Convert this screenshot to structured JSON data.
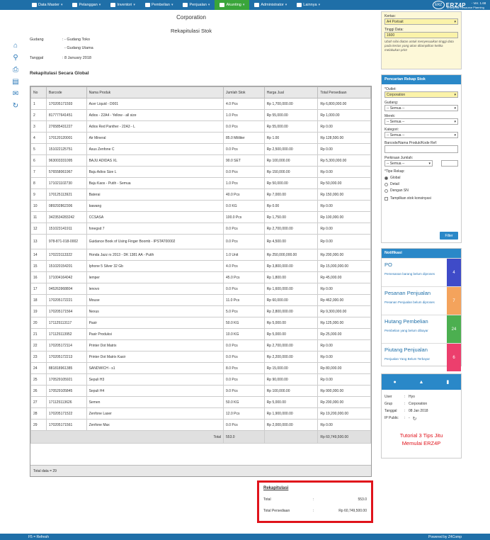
{
  "nav": {
    "items": [
      {
        "label": "Data Master",
        "icon": "list-icon"
      },
      {
        "label": "Pelanggan",
        "icon": "users-icon"
      },
      {
        "label": "Inventori",
        "icon": "box-icon"
      },
      {
        "label": "Pembelian",
        "icon": "cart-icon"
      },
      {
        "label": "Penjualan",
        "icon": "sales-icon"
      },
      {
        "label": "Akunting",
        "icon": "money-icon"
      },
      {
        "label": "Administrator",
        "icon": "gear-icon"
      },
      {
        "label": "Lainnya",
        "icon": "more-icon"
      }
    ],
    "active": "Akunting"
  },
  "brand": {
    "logo": "ERZ",
    "name": "ERZ4P",
    "version": "- Ver. 1.68",
    "tagline": "Enterprise Resource Planning"
  },
  "doc": {
    "company": "Corporation",
    "title": "Rekapitulasi Stok",
    "gudang_label": "Gudang",
    "gudang_1": ": - Gudang Toko",
    "gudang_2": "- Gudang Utama",
    "tanggal_label": "Tanggal",
    "tanggal_value": ": 8 January 2018",
    "section_title": "Rekapitulasi Secara Global"
  },
  "table": {
    "headers": [
      "No",
      "Barcode",
      "Nama Produk",
      "Jumlah Stok",
      "Harga Jual",
      "Total Persediaan"
    ],
    "rows": [
      [
        "1",
        "170205171593",
        "Acer Liquid - D001",
        "4.0 Pcs",
        "Rp 1,700,000.00",
        "Rp 6,800,000.00"
      ],
      [
        "2",
        "817777641451",
        "Adios - 22A4 - Yellow - all size",
        "1.0 Pcs",
        "Rp 55,000.00",
        "Rp 1,000.00"
      ],
      [
        "3",
        "276585431227",
        "Adios Red Panther - 22A3 - L",
        "0.0 Pcs",
        "Rp 55,000.00",
        "Rp 0.00"
      ],
      [
        "4",
        "170120120001",
        "Air Mineral",
        "85.0 Mililiter",
        "Rp 1.00",
        "Rp 128,500.00"
      ],
      [
        "5",
        "151022125751",
        "Asus Zenfone C",
        "0.0 Pcs",
        "Rp 2,500,000.00",
        "Rp 0.00"
      ],
      [
        "6",
        "963003331095",
        "BAJU ADIDAS XL",
        "90.0 SET",
        "Rp 100,000.00",
        "Rp 5,300,000.00"
      ],
      [
        "7",
        "576558061967",
        "Baju Adios Size L",
        "0.0 Pcs",
        "Rp 150,000.00",
        "Rp 0.00"
      ],
      [
        "8",
        "171021102730",
        "Baju Kaos - Putih - Semua",
        "1.0 Pcs",
        "Rp 50,000.00",
        "Rp 50,000.00"
      ],
      [
        "9",
        "170125113921",
        "Baterai",
        "40.0 Pcs",
        "Rp 7,000.00",
        "Rp 150,000.00"
      ],
      [
        "10",
        "089292862306",
        "bawang",
        "0.0 KG",
        "Rp 0.00",
        "Rp 0.00"
      ],
      [
        "11",
        "3423534283242",
        "CCSASA",
        "100.0 Pcs",
        "Rp 1,750.00",
        "Rp 100,000.00"
      ],
      [
        "12",
        "151023141911",
        "fonegsd 7",
        "0.0 Pcs",
        "Rp 2,700,000.00",
        "Rp 0.00"
      ],
      [
        "13",
        "978-871-018-0002",
        "Guidance Book of Using Finger Boomb - IPSTAT00002",
        "0.0 Pcs",
        "Rp 4,500.00",
        "Rp 0.00"
      ],
      [
        "14",
        "170223113322",
        "Honda Jazz rs 2013 - DK 1381 AA - Putih",
        "1.0 Unit",
        "Rp 250,000,000.00",
        "Rp 200,000.00"
      ],
      [
        "15",
        "151020154201",
        "Iphone 5 Silver 32 Gb",
        "4.0 Pcs",
        "Rp 3,800,000.00",
        "Rp 15,000,000.00"
      ],
      [
        "16",
        "171004164042",
        "lemper",
        "45.0 Pcs",
        "Rp 1,800.00",
        "Rp 45,000.00"
      ],
      [
        "17",
        "045263968804",
        "lenovo",
        "0.0 Pcs",
        "Rp 1,600,000.00",
        "Rp 0.00"
      ],
      [
        "18",
        "170205172221",
        "Mouse",
        "11.0 Pcs",
        "Rp 60,000.00",
        "Rp 462,000.00"
      ],
      [
        "19",
        "170205171564",
        "Nexus",
        "5.0 Pcs",
        "Rp 2,800,000.00",
        "Rp 9,300,000.00"
      ],
      [
        "20",
        "171125113117",
        "Pasir",
        "50.0 KG",
        "Rp 5,000.00",
        "Rp 125,000.00"
      ],
      [
        "21",
        "171125113952",
        "Pasir Produksi",
        "10.0 KG",
        "Rp 5,000.00",
        "Rp 25,000.00"
      ],
      [
        "22",
        "170205172114",
        "Printer Dot Matrix",
        "0.0 Pcs",
        "Rp 2,700,000.00",
        "Rp 0.00"
      ],
      [
        "23",
        "170205172213",
        "Printer Dot Matrix Kasir",
        "0.0 Pcs",
        "Rp 2,200,000.00",
        "Rp 0.00"
      ],
      [
        "24",
        "881818961385",
        "SANDWICH - s1",
        "8.0 Pcs",
        "Rp 15,000.00",
        "Rp 80,000.00"
      ],
      [
        "25",
        "170529105921",
        "Sepuli H3",
        "0.0 Pcs",
        "Rp 90,000.00",
        "Rp 0.00"
      ],
      [
        "26",
        "170529105845",
        "Sepuli H4",
        "9.0 Pcs",
        "Rp 100,000.00",
        "Rp 900,000.00"
      ],
      [
        "27",
        "171125113626",
        "Semen",
        "50.0 KG",
        "Rp 5,000.00",
        "Rp 200,000.00"
      ],
      [
        "28",
        "170205171522",
        "Zenfone Laser",
        "12.0 Pcs",
        "Rp 1,900,000.00",
        "Rp 19,200,000.00"
      ],
      [
        "29",
        "170205171561",
        "Zenfone Max",
        "0.0 Pcs",
        "Rp 2,000,000.00",
        "Rp 0.00"
      ]
    ],
    "total_label": "Total",
    "total_qty": "553.0",
    "total_value": "Rp 60,749,500.00",
    "total_data": "Total data = 29"
  },
  "rekap": {
    "title": "Rekapitulasi",
    "total_label": "Total",
    "total_value": "553.0",
    "persediaan_label": "Total Persediaan",
    "persediaan_value": "Rp 60,749,500.00",
    "sep": ":"
  },
  "print": {
    "kertas_label": "Kertas:",
    "kertas_value": "A4 Portrait",
    "tinggi_label": "Tinggi Data:",
    "tinggi_value": "1600",
    "note": "Ubah nilai diatas untuk menyesuaikan tinggi data pada kertas yang akan ditampilkan ketika melakukan print"
  },
  "filter": {
    "title": "Pencarian Rekap Stok",
    "outlet_label": "*Outlet:",
    "outlet_value": "Corporation",
    "gudang_label": "Gudang:",
    "gudang_value": "-- Semua --",
    "merek_label": "Merek:",
    "merek_value": "-- Semua --",
    "kategori_label": "Kategori:",
    "kategori_value": "-- Semua --",
    "barcode_label": "Barcode/Nama Produk/Kode Ref:",
    "jumlah_label": "Perkiraan Jumlah:",
    "jumlah_value": "-- Semua --",
    "tipe_label": "*Tipe Rekap:",
    "opt_global": "Global",
    "opt_detail": "Detail",
    "opt_sn": "Dengan SN",
    "konsinyasi": "Tampilkan stok konsinyasi",
    "button": "Filter"
  },
  "notifikasi": {
    "title": "Notifikasi",
    "items": [
      {
        "title": "PO",
        "desc": "Pemesanan barang belum diproses",
        "count": "4",
        "color": "#3f4bc8"
      },
      {
        "title": "Pesanan Penjualan",
        "desc": "Pesanan Penjualan belum diproses",
        "count": "7",
        "color": "#f4a35c"
      },
      {
        "title": "Hutang Pembelian",
        "desc": "Pembelian yang belum dibayar",
        "count": "24",
        "color": "#4caf50"
      },
      {
        "title": "Piutang Penjualan",
        "desc": "Penjualan Yang Belum Terbayar",
        "count": "6",
        "color": "#ec3f6d"
      }
    ]
  },
  "user": {
    "user_label": "User",
    "user_value": "Hyo",
    "grup_label": "Grup",
    "grup_value": "Corporation",
    "tanggal_label": "Tanggal",
    "tanggal_value": "08 Jan 2018",
    "public_label": "IP Public",
    "public_value": "-",
    "sep": ":",
    "tutorial_1": "Tutorial 3 Tips Jitu",
    "tutorial_2": "Memulai ERZ4P"
  },
  "footer": {
    "left": "F5 = Refresh",
    "right": "Powered by Z4Comp"
  }
}
